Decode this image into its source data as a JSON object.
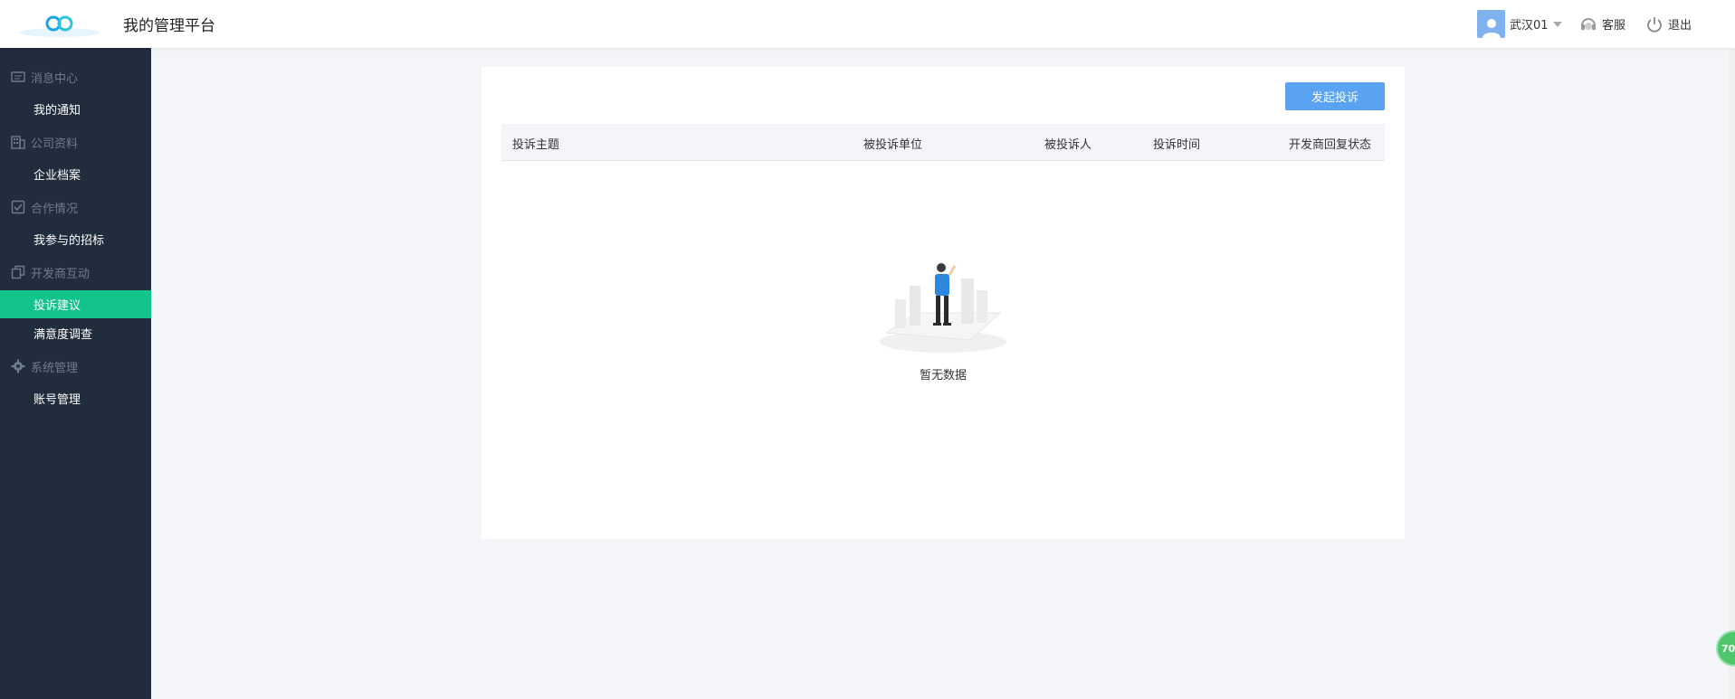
{
  "header": {
    "app_title": "我的管理平台",
    "user_name": "武汉01",
    "service_label": "客服",
    "logout_label": "退出",
    "brand_color": "#1aa3e8"
  },
  "sidebar": {
    "groups": [
      {
        "label": "消息中心",
        "icon": "message-icon",
        "items": [
          {
            "label": "我的通知"
          }
        ]
      },
      {
        "label": "公司资料",
        "icon": "building-icon",
        "items": [
          {
            "label": "企业档案"
          }
        ]
      },
      {
        "label": "合作情况",
        "icon": "checkbox-icon",
        "items": [
          {
            "label": "我参与的招标"
          }
        ]
      },
      {
        "label": "开发商互动",
        "icon": "copy-icon",
        "items": [
          {
            "label": "投诉建议",
            "active": true
          },
          {
            "label": "满意度调查"
          }
        ]
      },
      {
        "label": "系统管理",
        "icon": "gear-icon",
        "items": [
          {
            "label": "账号管理"
          }
        ]
      }
    ],
    "active_color": "#13c38b",
    "bg_color": "#212d3c"
  },
  "main": {
    "create_button": "发起投诉",
    "columns": [
      "投诉主题",
      "被投诉单位",
      "被投诉人",
      "投诉时间",
      "开发商回复状态"
    ],
    "rows": [],
    "empty_text": "暂无数据"
  },
  "float_badge": "70"
}
